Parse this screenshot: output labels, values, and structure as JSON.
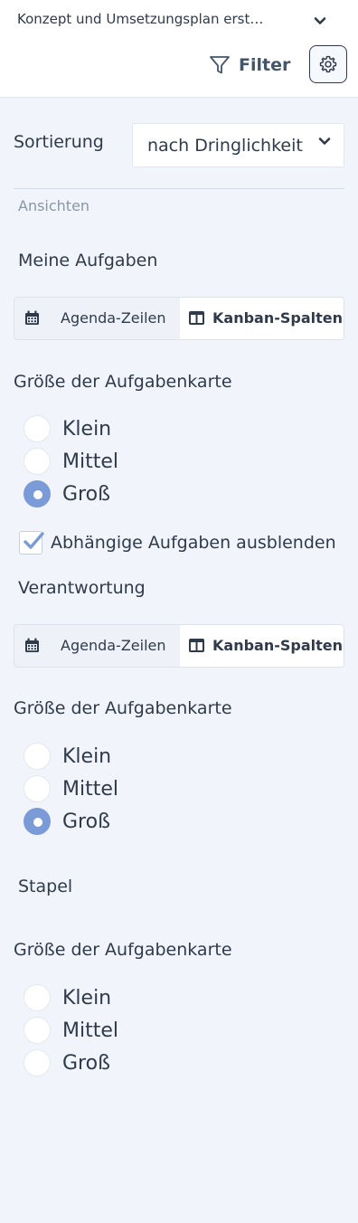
{
  "header": {
    "project_title": "Konzept und Umsetzungsplan erst…",
    "filter_label": "Filter"
  },
  "sorting": {
    "label": "Sortierung",
    "value": "nach Dringlichkeit"
  },
  "views_heading": "Ansichten",
  "groups": [
    {
      "title": "Meine Aufgaben",
      "toggle": {
        "agenda": "Agenda-Zeilen",
        "kanban": "Kanban-Spalten",
        "selected": "kanban"
      },
      "card_size": {
        "title": "Größe der Aufgabenkarte",
        "options": [
          "Klein",
          "Mittel",
          "Groß"
        ],
        "selected": "Groß"
      },
      "checkbox": {
        "label": "Abhängige Aufgaben ausblenden",
        "checked": true
      }
    },
    {
      "title": "Verantwortung",
      "toggle": {
        "agenda": "Agenda-Zeilen",
        "kanban": "Kanban-Spalten",
        "selected": "kanban"
      },
      "card_size": {
        "title": "Größe der Aufgabenkarte",
        "options": [
          "Klein",
          "Mittel",
          "Groß"
        ],
        "selected": "Groß"
      }
    },
    {
      "title": "Stapel",
      "card_size": {
        "title": "Größe der Aufgabenkarte",
        "options": [
          "Klein",
          "Mittel",
          "Groß"
        ],
        "selected": null
      }
    }
  ],
  "colors": {
    "panel_bg": "#f1f5fb",
    "radio_selected": "#7b9bd8",
    "text": "#2f3a4b"
  },
  "icons": [
    "chevron-down-icon",
    "filter-icon",
    "gear-icon",
    "calendar-icon",
    "columns-icon",
    "checkmark-icon"
  ]
}
